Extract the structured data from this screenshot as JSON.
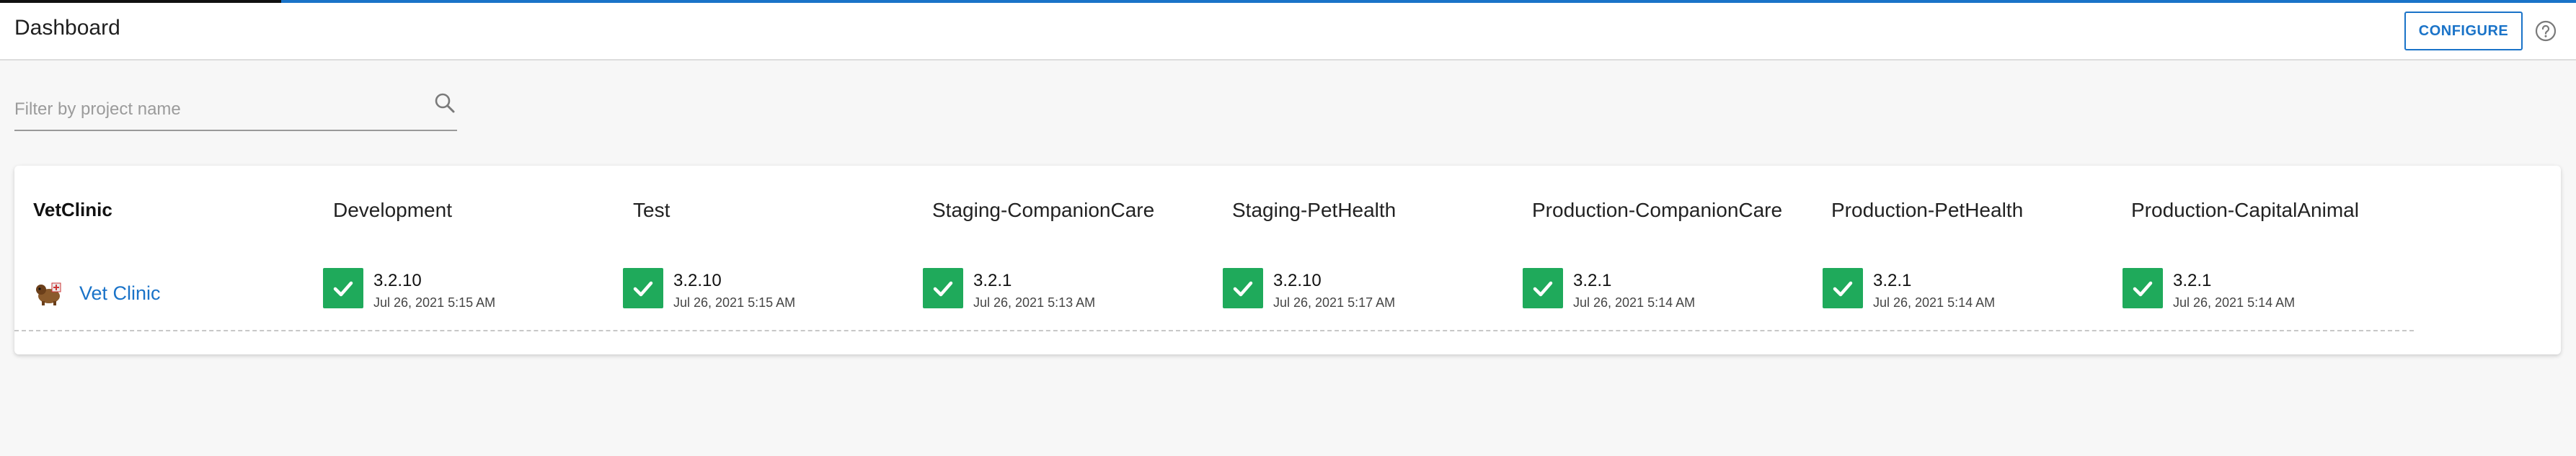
{
  "header": {
    "title": "Dashboard",
    "configure_label": "CONFIGURE",
    "help_icon": "help-circle-icon"
  },
  "filter": {
    "placeholder": "Filter by project name",
    "value": "",
    "icon": "search-icon"
  },
  "colors": {
    "accent": "#1a73c8",
    "success": "#1faa5b"
  },
  "table": {
    "project_group": "VetClinic",
    "environments": [
      "Development",
      "Test",
      "Staging-CompanionCare",
      "Staging-PetHealth",
      "Production-CompanionCare",
      "Production-PetHealth",
      "Production-CapitalAnimal"
    ],
    "rows": [
      {
        "project": "Vet Clinic",
        "logo": "vet-clinic-logo",
        "deployments": [
          {
            "version": "3.2.10",
            "date": "Jul 26, 2021 5:15 AM",
            "status": "success"
          },
          {
            "version": "3.2.10",
            "date": "Jul 26, 2021 5:15 AM",
            "status": "success"
          },
          {
            "version": "3.2.1",
            "date": "Jul 26, 2021 5:13 AM",
            "status": "success"
          },
          {
            "version": "3.2.10",
            "date": "Jul 26, 2021 5:17 AM",
            "status": "success"
          },
          {
            "version": "3.2.1",
            "date": "Jul 26, 2021 5:14 AM",
            "status": "success"
          },
          {
            "version": "3.2.1",
            "date": "Jul 26, 2021 5:14 AM",
            "status": "success"
          },
          {
            "version": "3.2.1",
            "date": "Jul 26, 2021 5:14 AM",
            "status": "success"
          }
        ]
      }
    ]
  }
}
